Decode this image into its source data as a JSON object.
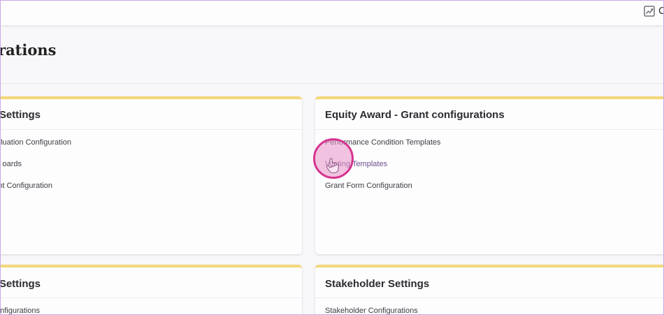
{
  "topbar": {
    "icon": "chart-icon",
    "user_text": "C"
  },
  "page": {
    "title": "rations"
  },
  "cards": [
    {
      "title": "l Settings",
      "links": [
        "luation Configuration",
        "oards",
        "nt Configuration"
      ]
    },
    {
      "title": "Equity Award - Grant configurations",
      "links": [
        "Performance Condition Templates",
        "Vesting Templates",
        "Grant Form Configuration"
      ]
    },
    {
      "title": "o Settings",
      "links": [
        "onfigurations"
      ]
    },
    {
      "title": "Stakeholder Settings",
      "links": [
        "Stakeholder Configurations"
      ]
    }
  ],
  "cursor": {
    "icon": "hand-pointer-icon",
    "ring_color": "#d6338f"
  }
}
